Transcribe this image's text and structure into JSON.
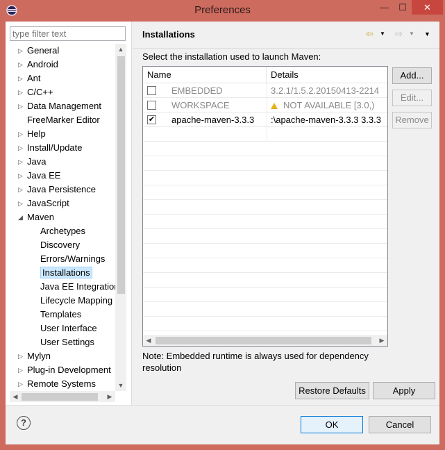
{
  "window": {
    "title": "Preferences",
    "minimize": "—",
    "maximize": "☐",
    "close": "✕"
  },
  "filter": {
    "placeholder": "type filter text"
  },
  "tree": [
    {
      "label": "General",
      "level": 0,
      "arrow": "▷"
    },
    {
      "label": "Android",
      "level": 0,
      "arrow": "▷"
    },
    {
      "label": "Ant",
      "level": 0,
      "arrow": "▷"
    },
    {
      "label": "C/C++",
      "level": 0,
      "arrow": "▷"
    },
    {
      "label": "Data Management",
      "level": 0,
      "arrow": "▷"
    },
    {
      "label": "FreeMarker Editor",
      "level": 0,
      "arrow": ""
    },
    {
      "label": "Help",
      "level": 0,
      "arrow": "▷"
    },
    {
      "label": "Install/Update",
      "level": 0,
      "arrow": "▷"
    },
    {
      "label": "Java",
      "level": 0,
      "arrow": "▷"
    },
    {
      "label": "Java EE",
      "level": 0,
      "arrow": "▷"
    },
    {
      "label": "Java Persistence",
      "level": 0,
      "arrow": "▷"
    },
    {
      "label": "JavaScript",
      "level": 0,
      "arrow": "▷"
    },
    {
      "label": "Maven",
      "level": 0,
      "arrow": "◢"
    },
    {
      "label": "Archetypes",
      "level": 1,
      "arrow": ""
    },
    {
      "label": "Discovery",
      "level": 1,
      "arrow": ""
    },
    {
      "label": "Errors/Warnings",
      "level": 1,
      "arrow": ""
    },
    {
      "label": "Installations",
      "level": 1,
      "arrow": "",
      "selected": true
    },
    {
      "label": "Java EE Integration",
      "level": 1,
      "arrow": ""
    },
    {
      "label": "Lifecycle Mapping",
      "level": 1,
      "arrow": ""
    },
    {
      "label": "Templates",
      "level": 1,
      "arrow": ""
    },
    {
      "label": "User Interface",
      "level": 1,
      "arrow": ""
    },
    {
      "label": "User Settings",
      "level": 1,
      "arrow": ""
    },
    {
      "label": "Mylyn",
      "level": 0,
      "arrow": "▷"
    },
    {
      "label": "Plug-in Development",
      "level": 0,
      "arrow": "▷"
    },
    {
      "label": "Remote Systems",
      "level": 0,
      "arrow": "▷"
    }
  ],
  "page": {
    "title": "Installations",
    "instruction": "Select the installation used to launch Maven:",
    "table": {
      "headers": {
        "name": "Name",
        "details": "Details"
      },
      "rows": [
        {
          "name": "EMBEDDED",
          "details": "3.2.1/1.5.2.20150413-2214",
          "checked": "",
          "dim": true,
          "warn": false
        },
        {
          "name": "WORKSPACE",
          "details": "NOT AVAILABLE [3.0,)",
          "checked": "",
          "dim": true,
          "warn": true
        },
        {
          "name": "apache-maven-3.3.3",
          "details": ":\\apache-maven-3.3.3 3.3.3",
          "checked": "✔",
          "dim": false,
          "warn": false
        }
      ]
    },
    "buttons": {
      "add": "Add...",
      "edit": "Edit...",
      "remove": "Remove",
      "restore_defaults": "Restore Defaults",
      "apply": "Apply"
    },
    "note": "Note: Embedded runtime is always used for dependency resolution"
  },
  "dialog": {
    "ok": "OK",
    "cancel": "Cancel",
    "help": "?"
  },
  "icons": {
    "back": "⇦",
    "forward": "⇨",
    "dropdown": "▼"
  },
  "colors": {
    "titlebar": "#cd6b5f",
    "selection": "#cce8ff",
    "accent": "#0078d7"
  }
}
